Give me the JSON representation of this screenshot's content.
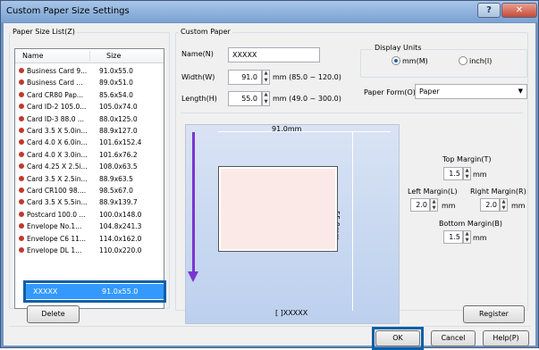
{
  "window": {
    "title": "Custom Paper Size Settings",
    "help_glyph": "?",
    "close_glyph": "✕"
  },
  "paper_list": {
    "label": "Paper Size List(Z)",
    "col_name": "Name",
    "col_size": "Size",
    "items": [
      {
        "name": "Business Card 9...",
        "size": "91.0x55.0"
      },
      {
        "name": "Business Card ...",
        "size": "89.0x51.0"
      },
      {
        "name": "Card CR80 Pap...",
        "size": "85.6x54.0"
      },
      {
        "name": "Card ID-2 105.0...",
        "size": "105.0x74.0"
      },
      {
        "name": "Card ID-3 88.0 ...",
        "size": "88.0x125.0"
      },
      {
        "name": "Card 3.5 X 5.0in...",
        "size": "88.9x127.0"
      },
      {
        "name": "Card 4.0 X 6.0in...",
        "size": "101.6x152.4"
      },
      {
        "name": "Card 4.0 X 3.0in...",
        "size": "101.6x76.2"
      },
      {
        "name": "Card 4.25 X 2.5i...",
        "size": "108.0x63.5"
      },
      {
        "name": "Card 3.5 X 2.5in...",
        "size": "88.9x63.5"
      },
      {
        "name": "Card CR100 98....",
        "size": "98.5x67.0"
      },
      {
        "name": "Card 3.5 X 5.5in...",
        "size": "88.9x139.7"
      },
      {
        "name": "Postcard 100.0 ...",
        "size": "100.0x148.0"
      },
      {
        "name": "Envelope No.1...",
        "size": "104.8x241.3"
      },
      {
        "name": "Envelope C6 11...",
        "size": "114.0x162.0"
      },
      {
        "name": "Envelope DL 1...",
        "size": "110.0x220.0"
      }
    ],
    "selected": {
      "name": "XXXXX",
      "size": "91.0x55.0"
    }
  },
  "custom_paper": {
    "label": "Custom Paper",
    "name_label": "Name(N)",
    "name_value": "XXXXX",
    "width_label": "Width(W)",
    "width_value": "91.0",
    "width_range": "mm (85.0 ~ 120.0)",
    "length_label": "Length(H)",
    "length_value": "55.0",
    "length_range": "mm (49.0 ~ 300.0)"
  },
  "display_units": {
    "label": "Display Units",
    "mm_label": "mm(M)",
    "inch_label": "inch(I)",
    "selected": "mm"
  },
  "paper_form": {
    "label": "Paper Form(O)",
    "value": "Paper"
  },
  "preview": {
    "width_label": "91.0mm",
    "length_label": "55.0mm",
    "name_label": "[ ]XXXXX"
  },
  "margins": {
    "top_label": "Top Margin(T)",
    "top_value": "1.5",
    "left_label": "Left Margin(L)",
    "left_value": "2.0",
    "right_label": "Right Margin(R)",
    "right_value": "2.0",
    "bottom_label": "Bottom Margin(B)",
    "bottom_value": "1.5",
    "unit": "mm"
  },
  "buttons": {
    "delete": "Delete",
    "register": "Register",
    "ok": "OK",
    "cancel": "Cancel",
    "help": "Help(P)"
  },
  "colors": {
    "selection": "#3399ff",
    "highlight_outline": "#0d5fa8",
    "arrow": "#7a35d0",
    "list_dot": "#c0392b"
  }
}
